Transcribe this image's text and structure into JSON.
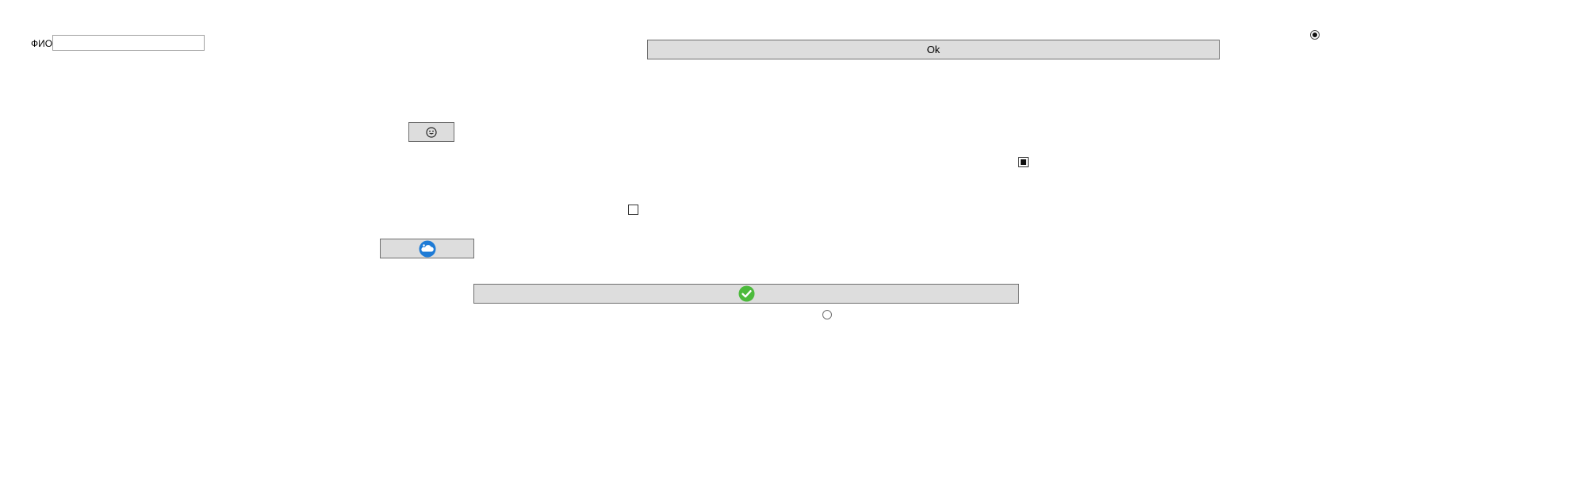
{
  "form": {
    "fio_label": "ФИО",
    "fio_value": "",
    "ok_button_label": "Ok"
  },
  "controls": {
    "radio_top_right": {
      "checked": true
    },
    "radio_bottom": {
      "checked": false
    },
    "checkbox_right": {
      "checked": true,
      "style": "indeterminate-square"
    },
    "checkbox_middle": {
      "checked": false
    }
  },
  "icons": {
    "smiley_button_icon": "smiley-face-icon",
    "cloud_button_icon": "cloud-icon",
    "check_button_icon": "green-checkmark-icon"
  },
  "colors": {
    "button_bg": "#dddddd",
    "button_border": "#6e6e6e",
    "cloud_blue": "#1e7bd6",
    "check_green": "#4cba3c"
  }
}
